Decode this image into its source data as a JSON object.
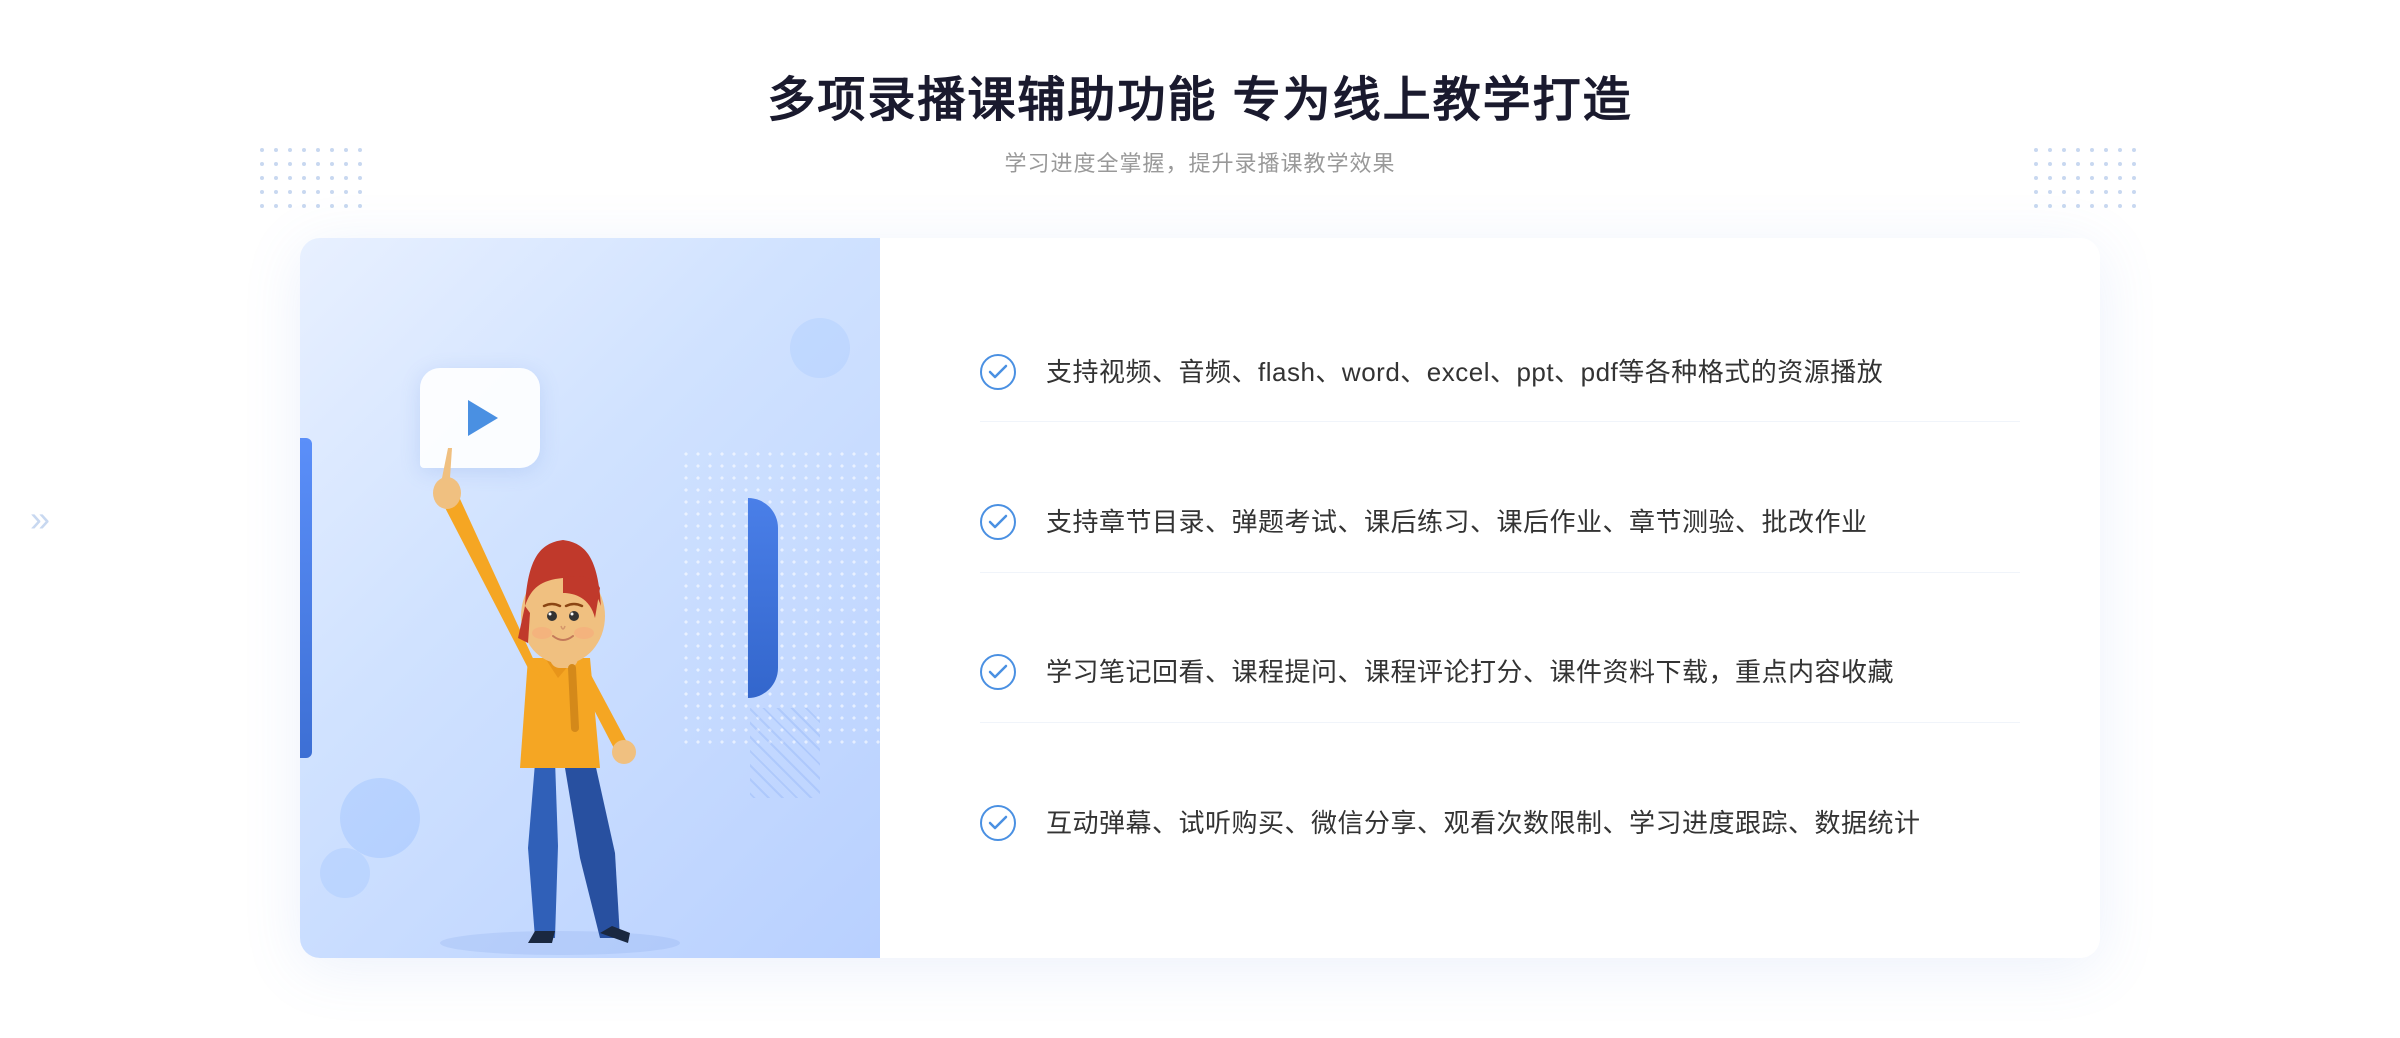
{
  "header": {
    "title": "多项录播课辅助功能 专为线上教学打造",
    "subtitle": "学习进度全掌握，提升录播课教学效果"
  },
  "features": [
    {
      "id": 1,
      "text": "支持视频、音频、flash、word、excel、ppt、pdf等各种格式的资源播放"
    },
    {
      "id": 2,
      "text": "支持章节目录、弹题考试、课后练习、课后作业、章节测验、批改作业"
    },
    {
      "id": 3,
      "text": "学习笔记回看、课程提问、课程评论打分、课件资料下载，重点内容收藏"
    },
    {
      "id": 4,
      "text": "互动弹幕、试听购买、微信分享、观看次数限制、学习进度跟踪、数据统计"
    }
  ],
  "colors": {
    "title": "#1a1a2e",
    "subtitle": "#999999",
    "accent_blue": "#4a7fe8",
    "feature_text": "#333333",
    "check_color": "#4a90e2",
    "bg_gradient_start": "#e8f0ff",
    "bg_gradient_end": "#b8d0ff"
  },
  "decorations": {
    "chevron_symbol": "»",
    "dot_symbol": "·"
  }
}
